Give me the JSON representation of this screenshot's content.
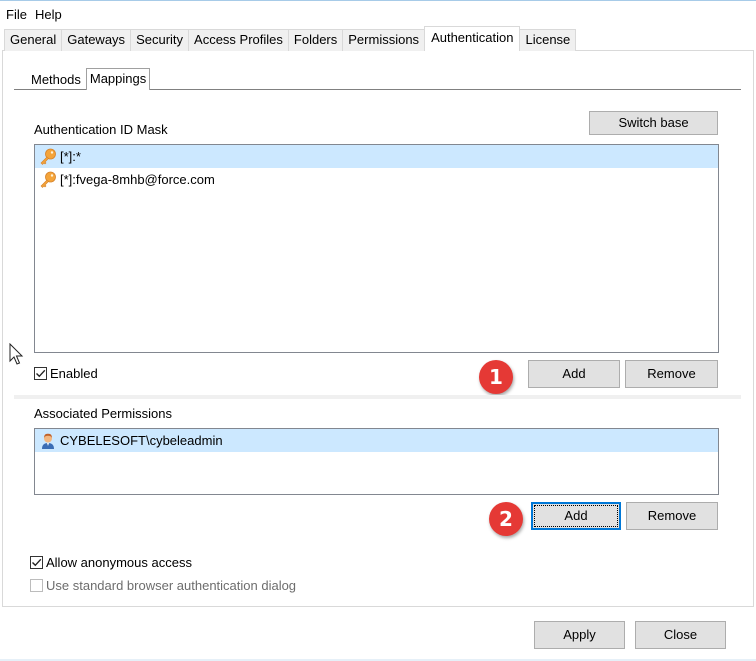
{
  "menu": {
    "items": [
      "File",
      "Help"
    ]
  },
  "tabs": {
    "items": [
      "General",
      "Gateways",
      "Security",
      "Access Profiles",
      "Folders",
      "Permissions",
      "Authentication",
      "License"
    ],
    "active": "Authentication"
  },
  "subtabs": {
    "items": [
      "Methods",
      "Mappings"
    ],
    "active": "Mappings"
  },
  "auth_mask": {
    "label": "Authentication ID Mask",
    "switch_base_label": "Switch base",
    "items": [
      {
        "text": "[*]:*",
        "icon": "key-icon",
        "selected": true
      },
      {
        "text": "[*]:fvega-8mhb@force.com",
        "icon": "key-icon",
        "selected": false
      }
    ],
    "enabled_label": "Enabled",
    "enabled_checked": true,
    "add_label": "Add",
    "remove_label": "Remove"
  },
  "permissions": {
    "label": "Associated Permissions",
    "items": [
      {
        "text": "CYBELESOFT\\cybeleadmin",
        "icon": "user-icon",
        "selected": true
      }
    ],
    "add_label": "Add",
    "remove_label": "Remove"
  },
  "options": {
    "allow_anonymous_label": "Allow anonymous access",
    "allow_anonymous_checked": true,
    "browser_auth_label": "Use standard browser authentication dialog",
    "browser_auth_checked": false,
    "browser_auth_enabled": false
  },
  "footer": {
    "apply_label": "Apply",
    "close_label": "Close"
  },
  "callouts": [
    "1",
    "2"
  ],
  "colors": {
    "selection": "#cce8ff",
    "callout": "#e53935",
    "focus": "#0078d7"
  }
}
